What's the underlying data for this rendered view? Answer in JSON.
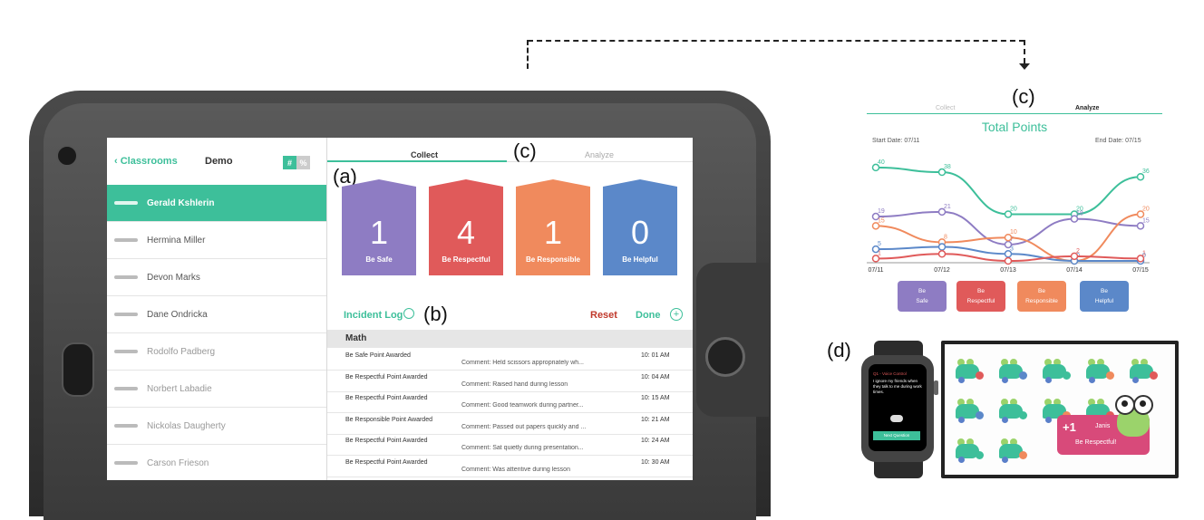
{
  "labels": {
    "c_top": "(c)",
    "c_screen": "(c)",
    "a": "(a)",
    "b": "(b)",
    "d": "(d)"
  },
  "sidebar": {
    "back_label": "Classrooms",
    "title": "Demo",
    "toggle": [
      "#",
      "%"
    ],
    "students": [
      {
        "name": "Gerald Kshlerin",
        "state": "selected"
      },
      {
        "name": "Hermina Miller",
        "state": "normal"
      },
      {
        "name": "Devon Marks",
        "state": "normal"
      },
      {
        "name": "Dane Ondricka",
        "state": "normal"
      },
      {
        "name": "Rodolfo Padberg",
        "state": "dim"
      },
      {
        "name": "Norbert Labadie",
        "state": "dim"
      },
      {
        "name": "Nickolas Daugherty",
        "state": "dim"
      },
      {
        "name": "Carson Frieson",
        "state": "dim"
      }
    ]
  },
  "tabs": {
    "collect": "Collect",
    "analyze": "Analyze"
  },
  "cards": [
    {
      "value": "1",
      "label": "Be Safe",
      "color": "#8e7cc3"
    },
    {
      "value": "4",
      "label": "Be Respectful",
      "color": "#e05a5a"
    },
    {
      "value": "1",
      "label": "Be Responsible",
      "color": "#f08a5d"
    },
    {
      "value": "0",
      "label": "Be Helpful",
      "color": "#5b88c9"
    }
  ],
  "incident": {
    "title": "Incident Log",
    "reset": "Reset",
    "done": "Done"
  },
  "log": {
    "section": "Math",
    "rows": [
      {
        "type": "Be Safe Point Awarded",
        "comment": "Comment: Held scissors appropriately wh...",
        "time": "10: 01 AM"
      },
      {
        "type": "Be Respectful Point Awarded",
        "comment": "Comment: Raised hand during lesson",
        "time": "10: 04 AM"
      },
      {
        "type": "Be Respectful Point Awarded",
        "comment": "Comment: Good teamwork during partner...",
        "time": "10: 15 AM"
      },
      {
        "type": "Be Responsible Point Awarded",
        "comment": "Comment: Passed out papers quickly and ...",
        "time": "10: 21 AM"
      },
      {
        "type": "Be Respectful Point Awarded",
        "comment": "Comment: Sat quietly during presentation...",
        "time": "10: 24 AM"
      },
      {
        "type": "Be Respectful Point Awarded",
        "comment": "Comment: Was attentive during lesson",
        "time": "10: 30 AM"
      }
    ]
  },
  "analyze": {
    "tab_collect": "Collect",
    "tab_analyze": "Analyze",
    "title": "Total Points",
    "start_date": "Start Date:  07/11",
    "end_date": "End Date:  07/15",
    "legend": [
      {
        "label_1": "Be",
        "label_2": "Safe",
        "color": "#8e7cc3"
      },
      {
        "label_1": "Be",
        "label_2": "Respectful",
        "color": "#e05a5a"
      },
      {
        "label_1": "Be",
        "label_2": "Responsible",
        "color": "#f08a5d"
      },
      {
        "label_1": "Be",
        "label_2": "Helpful",
        "color": "#5b88c9"
      }
    ]
  },
  "chart_data": {
    "type": "line",
    "title": "Total Points",
    "x": [
      "07/11",
      "07/12",
      "07/13",
      "07/14",
      "07/15"
    ],
    "ylim": [
      0,
      45
    ],
    "grid": false,
    "series": [
      {
        "color": "#3dbf9a",
        "values": [
          40,
          38,
          20,
          20,
          36
        ],
        "labels": [
          "40",
          "38",
          "20",
          "20",
          "36"
        ]
      },
      {
        "color": "#8e7cc3",
        "values": [
          19,
          21,
          7,
          18,
          15
        ],
        "labels": [
          "19",
          "21",
          "7",
          "18",
          "15"
        ]
      },
      {
        "color": "#f08a5d",
        "values": [
          15,
          8,
          10,
          0,
          20
        ],
        "labels": [
          "15",
          "8",
          "10",
          "",
          "20"
        ]
      },
      {
        "color": "#5b88c9",
        "values": [
          5,
          6,
          3,
          0,
          0
        ],
        "labels": [
          "5",
          "",
          "3",
          "0",
          "0"
        ]
      },
      {
        "color": "#e05a5a",
        "values": [
          1,
          3,
          0,
          2,
          1
        ],
        "labels": [
          "1",
          "",
          "",
          "2",
          "1"
        ]
      }
    ]
  },
  "watch": {
    "title": "Q1 - Voice Control",
    "question": "I ignore my friends when they talk to me during work times.",
    "button": "Next Question"
  },
  "tv": {
    "plus": "+1",
    "name": "Janis",
    "message": "Be Respectful!"
  }
}
